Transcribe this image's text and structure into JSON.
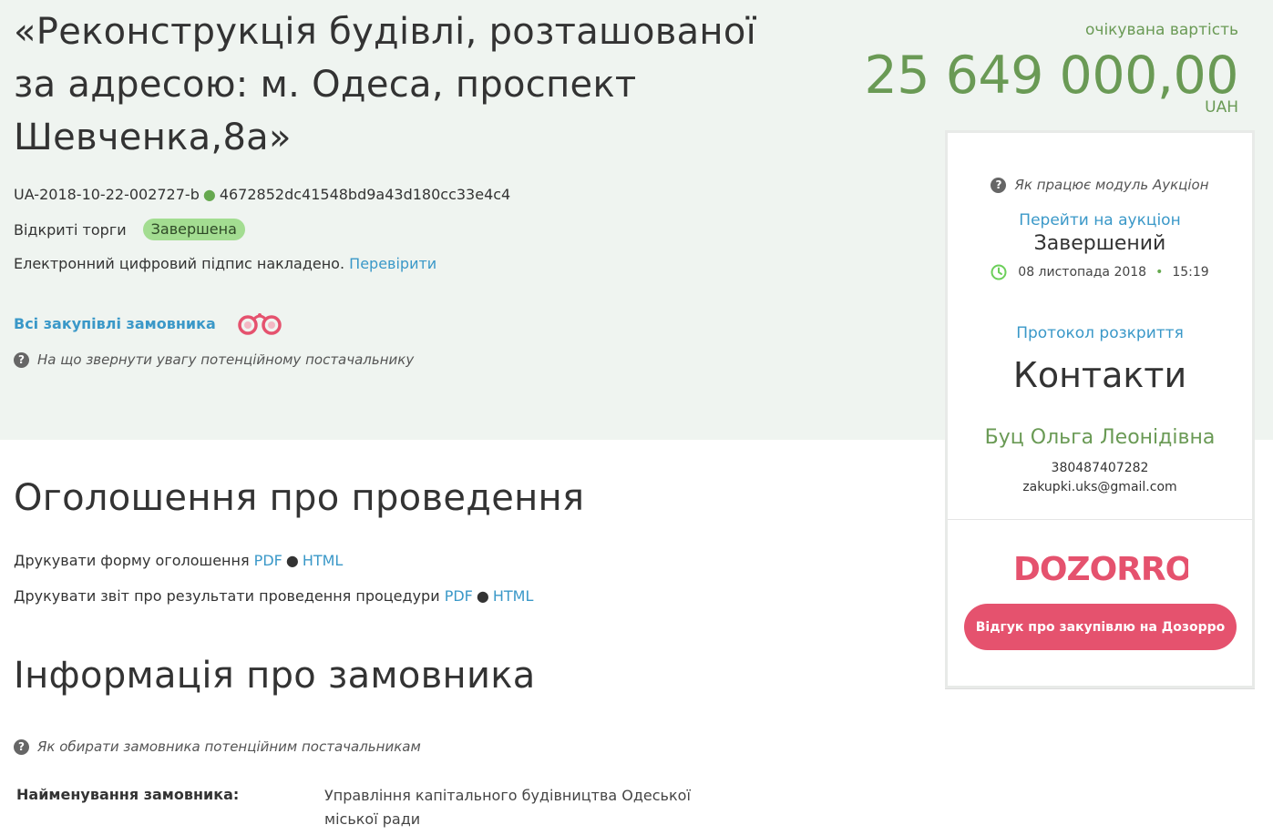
{
  "tender": {
    "title": "«Реконструкція будівлі, розташованої за адресою: м. Одеса, проспект Шевченка,8а»",
    "id": "UA-2018-10-22-002727-b",
    "hash": "4672852dc41548bd9a43d180cc33e4c4",
    "procedure_type": "Відкриті торги",
    "status_badge": "Завершена",
    "signature_text": "Електронний цифровий підпис накладено.",
    "signature_link": "Перевірити",
    "all_purchases_link": "Всі закупівлі замовника",
    "supplier_hint": "На що звернути увагу потенційному постачальнику"
  },
  "price": {
    "label": "очікувана вартість",
    "value": "25 649 000,00",
    "currency": "UAH"
  },
  "sidebar": {
    "auction_hint": "Як працює модуль Аукціон",
    "auction_link": "Перейти на аукціон",
    "auction_status": "Завершений",
    "auction_date": "08 листопада 2018",
    "auction_time": "15:19",
    "protocol_link": "Протокол розкриття",
    "contacts_title": "Контакти",
    "contact_name": "Буц Ольга Леонідівна",
    "contact_phone": "380487407282",
    "contact_email": "zakupki.uks@gmail.com",
    "feedback_button": "Відгук про закупівлю на Дозорро"
  },
  "announcement": {
    "heading": "Оголошення про проведення",
    "print_form_text": "Друкувати форму оголошення",
    "print_report_text": "Друкувати звіт про результати проведення процедури",
    "pdf_label": "PDF",
    "html_label": "HTML"
  },
  "customer": {
    "heading": "Інформація про замовника",
    "hint": "Як обирати замовника потенційним постачальникам",
    "name_label": "Найменування замовника:",
    "name_value": "Управління капітального будівництва Одеської міської ради"
  },
  "icons": {
    "question": "question-circle-icon",
    "clock": "clock-icon",
    "binoculars": "binoculars-icon",
    "logo": "dozorro-logo"
  },
  "colors": {
    "hero_bg": "#eff4f0",
    "green": "#6a9a55",
    "link": "#3a98c8",
    "badge": "#a3dd91",
    "dozorro": "#e5526e"
  }
}
